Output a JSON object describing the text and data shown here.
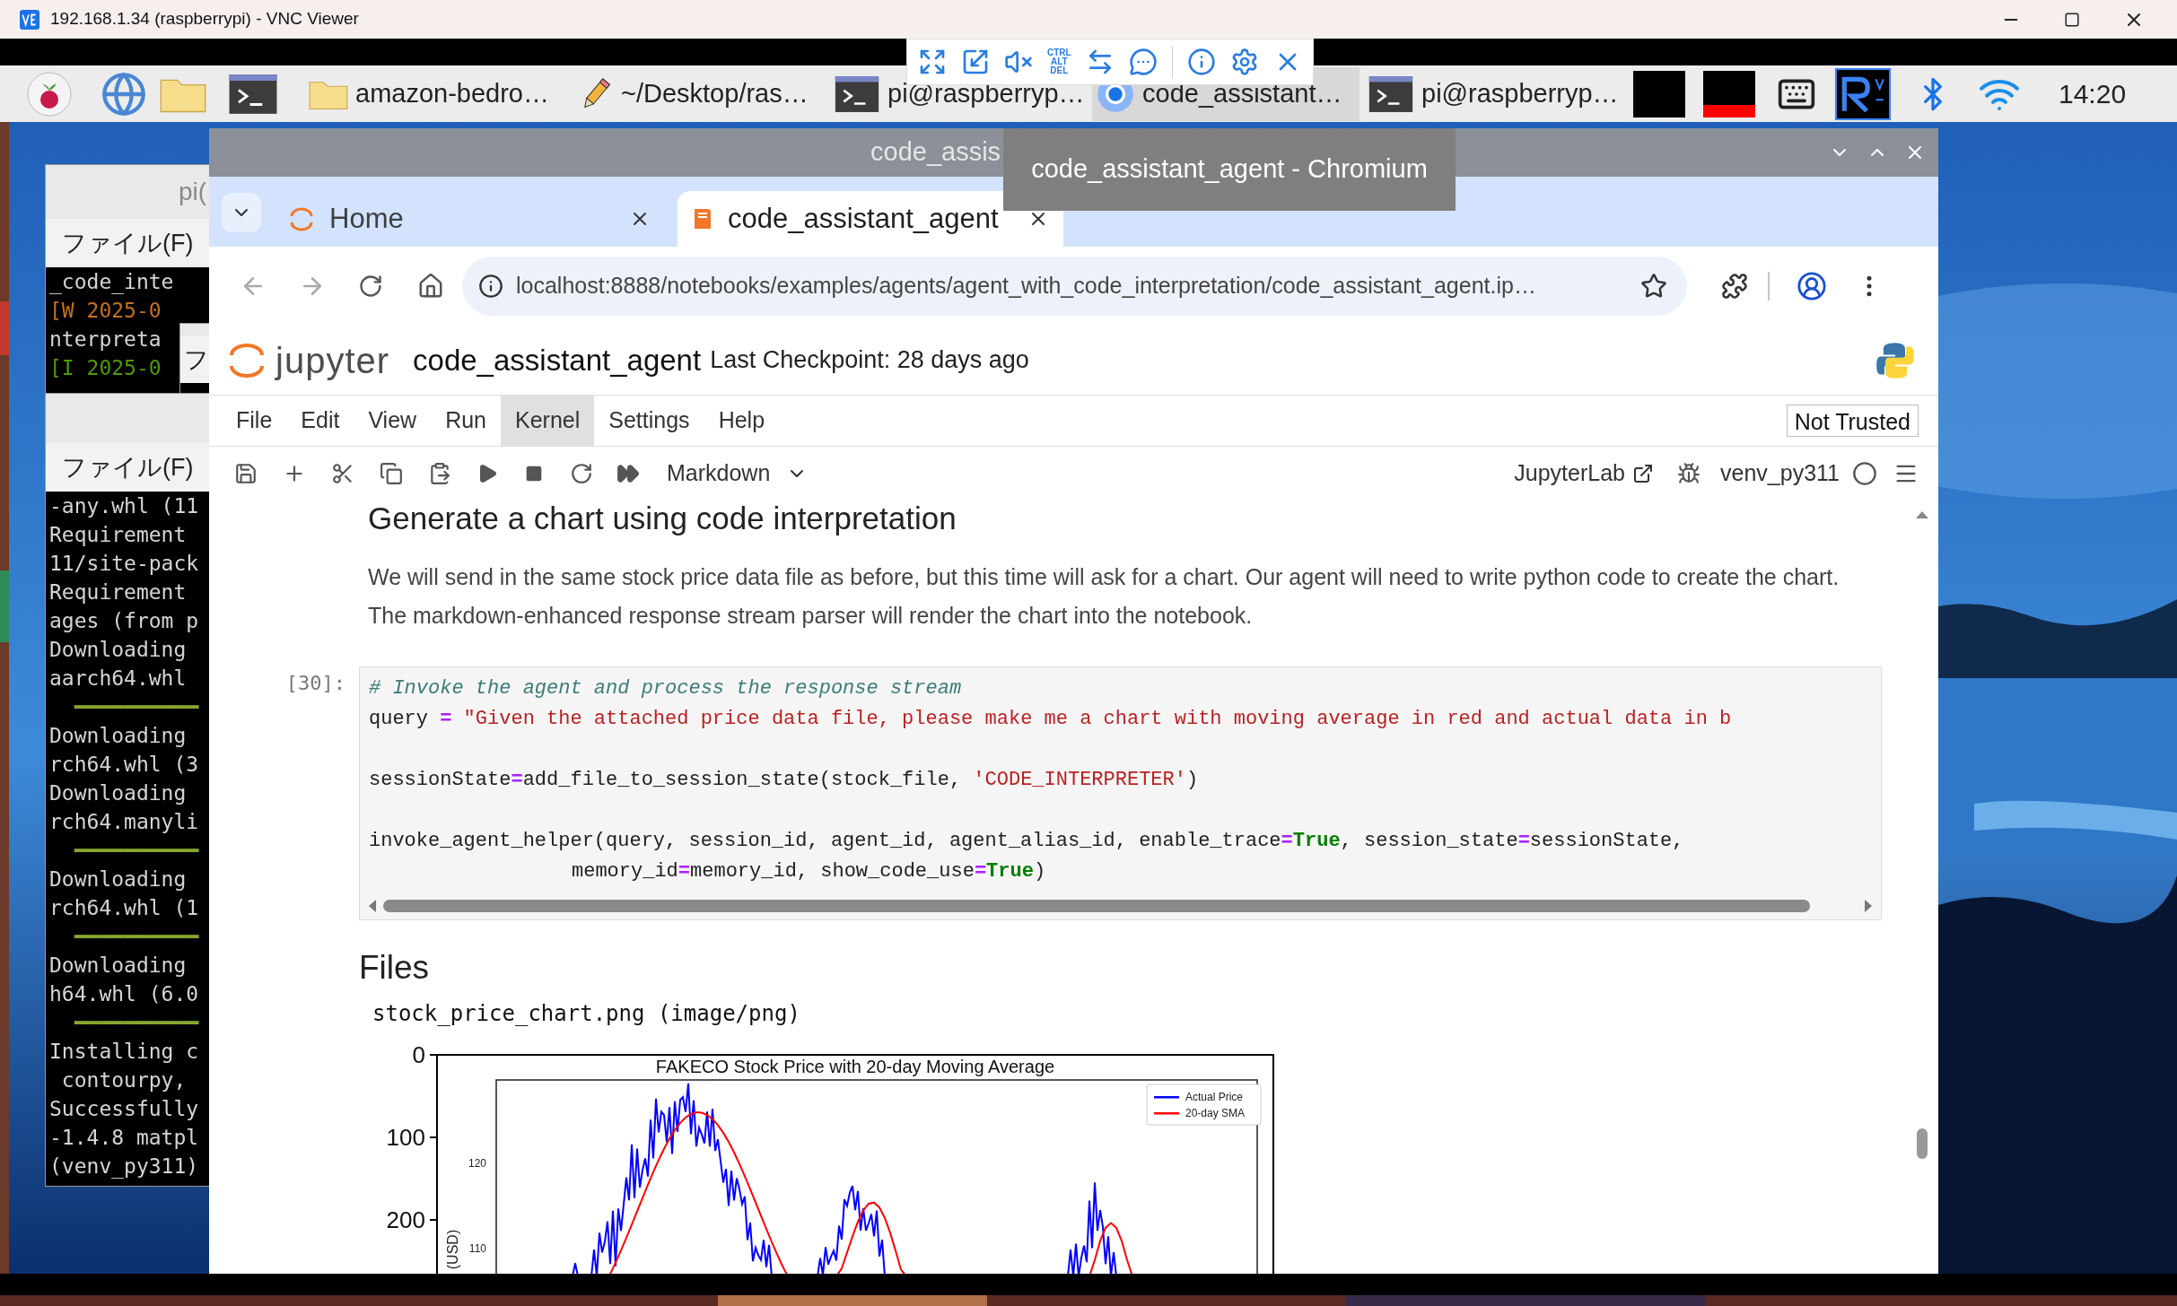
{
  "vnc": {
    "title": "192.168.1.34 (raspberrypi) - VNC Viewer",
    "toolbar_keys": [
      "CTRL",
      "ALT",
      "DEL"
    ]
  },
  "taskbar": {
    "tasks": [
      {
        "kind": "folder",
        "label": "amazon-bedro…",
        "selected": false
      },
      {
        "kind": "editor",
        "label": "~/Desktop/ras…",
        "selected": false
      },
      {
        "kind": "terminal",
        "label": "pi@raspberryp…",
        "selected": false
      },
      {
        "kind": "browser",
        "label": "code_assistant…",
        "selected": true
      },
      {
        "kind": "terminal",
        "label": "pi@raspberryp…",
        "selected": false
      }
    ],
    "clock": "14:20"
  },
  "terminals": [
    {
      "title": "pi(",
      "menu": "ファイル(F)",
      "lines": [
        {
          "kind": "text",
          "text": "_code_inte"
        },
        {
          "kind": "text",
          "text": "[W 2025-0",
          "color": "#c4711e"
        },
        {
          "kind": "text",
          "text": "nterpreta"
        },
        {
          "kind": "text",
          "text": "[I 2025-0",
          "color": "#4e9a06"
        }
      ]
    },
    {
      "menu": "フ"
    },
    {
      "menu": "ファイル(F)",
      "lines": [
        {
          "kind": "text",
          "text": "-any.whl (11"
        },
        {
          "kind": "text",
          "text": "Requirement"
        },
        {
          "kind": "text",
          "text": "11/site-pack"
        },
        {
          "kind": "text",
          "text": "Requirement"
        },
        {
          "kind": "text",
          "text": "ages (from p"
        },
        {
          "kind": "text",
          "text": "Downloading"
        },
        {
          "kind": "text",
          "text": "aarch64.whl"
        },
        {
          "kind": "bar",
          "text": "━━━━━━━━━━"
        },
        {
          "kind": "text",
          "text": "Downloading"
        },
        {
          "kind": "text",
          "text": "rch64.whl (3"
        },
        {
          "kind": "text",
          "text": "Downloading"
        },
        {
          "kind": "text",
          "text": "rch64.manyli"
        },
        {
          "kind": "bar",
          "text": "━━━━━━━━━━"
        },
        {
          "kind": "text",
          "text": "Downloading"
        },
        {
          "kind": "text",
          "text": "rch64.whl (1"
        },
        {
          "kind": "bar",
          "text": "━━━━━━━━━━"
        },
        {
          "kind": "text",
          "text": "Downloading"
        },
        {
          "kind": "text",
          "text": "h64.whl (6.0"
        },
        {
          "kind": "bar",
          "text": "━━━━━━━━━━"
        },
        {
          "kind": "text",
          "text": "Installing c"
        },
        {
          "kind": "text",
          "text": " contourpy,"
        },
        {
          "kind": "text",
          "text": "Successfully"
        },
        {
          "kind": "text",
          "text": "-1.4.8 matpl"
        },
        {
          "kind": "text",
          "text": "(venv_py311)"
        }
      ]
    }
  ],
  "browser": {
    "title": "code_assis",
    "tooltip": "code_assistant_agent - Chromium",
    "tabs": [
      {
        "label": "Home",
        "selected": false
      },
      {
        "label": "code_assistant_agent",
        "selected": true
      }
    ],
    "url": "localhost:8888/notebooks/examples/agents/agent_with_code_interpretation/code_assistant_agent.ip…"
  },
  "jupyter": {
    "logo_text": "jupyter",
    "notebook_name": "code_assistant_agent",
    "checkpoint": "Last Checkpoint: 28 days ago",
    "menu": [
      {
        "label": "File",
        "selected": false
      },
      {
        "label": "Edit",
        "selected": false
      },
      {
        "label": "View",
        "selected": false
      },
      {
        "label": "Run",
        "selected": false
      },
      {
        "label": "Kernel",
        "selected": true
      },
      {
        "label": "Settings",
        "selected": false
      },
      {
        "label": "Help",
        "selected": false
      }
    ],
    "trust": "Not Trusted",
    "cell_type": "Markdown",
    "jupyterlab": "JupyterLab",
    "kernel": "venv_py311"
  },
  "notebook": {
    "heading": "Generate a chart using code interpretation",
    "paragraph": "We will send in the same stock price data file as before, but this time will ask for a chart. Our agent will need to write python code to create the chart. The markdown-enhanced response stream parser will render the chart into the notebook.",
    "cell": {
      "prompt": "[30]:",
      "lines": [
        {
          "kind": "code",
          "tokens": [
            {
              "kind": "comment",
              "text": "# Invoke the agent and process the response stream"
            }
          ]
        },
        {
          "kind": "code",
          "tokens": [
            {
              "kind": "plain",
              "text": "query "
            },
            {
              "kind": "operator",
              "text": "="
            },
            {
              "kind": "string",
              "text": " \"Given the attached price data file, please make me a chart with moving average in red and actual data in b"
            }
          ]
        },
        {
          "kind": "blank"
        },
        {
          "kind": "code",
          "tokens": [
            {
              "kind": "plain",
              "text": "sessionState"
            },
            {
              "kind": "operator",
              "text": "="
            },
            {
              "kind": "plain",
              "text": "add_file_to_session_state(stock_file, "
            },
            {
              "kind": "string",
              "text": "'CODE_INTERPRETER'"
            },
            {
              "kind": "plain",
              "text": ")"
            }
          ]
        },
        {
          "kind": "blank"
        },
        {
          "kind": "code",
          "tokens": [
            {
              "kind": "plain",
              "text": "invoke_agent_helper(query, session_id, agent_id, agent_alias_id, enable_trace"
            },
            {
              "kind": "operator",
              "text": "="
            },
            {
              "kind": "keyword",
              "text": "True"
            },
            {
              "kind": "plain",
              "text": ", session_state"
            },
            {
              "kind": "operator",
              "text": "="
            },
            {
              "kind": "plain",
              "text": "sessionState,"
            }
          ]
        },
        {
          "kind": "continued",
          "tokens": [
            {
              "kind": "plain",
              "text": "memory_id"
            },
            {
              "kind": "operator",
              "text": "="
            },
            {
              "kind": "plain",
              "text": "memory_id, show_code_use"
            },
            {
              "kind": "operator",
              "text": "="
            },
            {
              "kind": "keyword",
              "text": "True"
            },
            {
              "kind": "plain",
              "text": ")"
            }
          ]
        }
      ]
    },
    "files_heading": "Files",
    "file_name": "stock_price_chart.png (image/png)",
    "chart_image": {
      "title": "FAKECO Stock Price with 20-day Moving Average",
      "outer_yticks": [
        "0",
        "100",
        "200"
      ],
      "inner_yticks": [
        "120",
        "110"
      ],
      "ylabel": "(USD)",
      "legend": [
        {
          "label": "Actual Price",
          "color": "#0000ff"
        },
        {
          "label": "20-day SMA",
          "color": "#ff0000"
        }
      ]
    }
  }
}
